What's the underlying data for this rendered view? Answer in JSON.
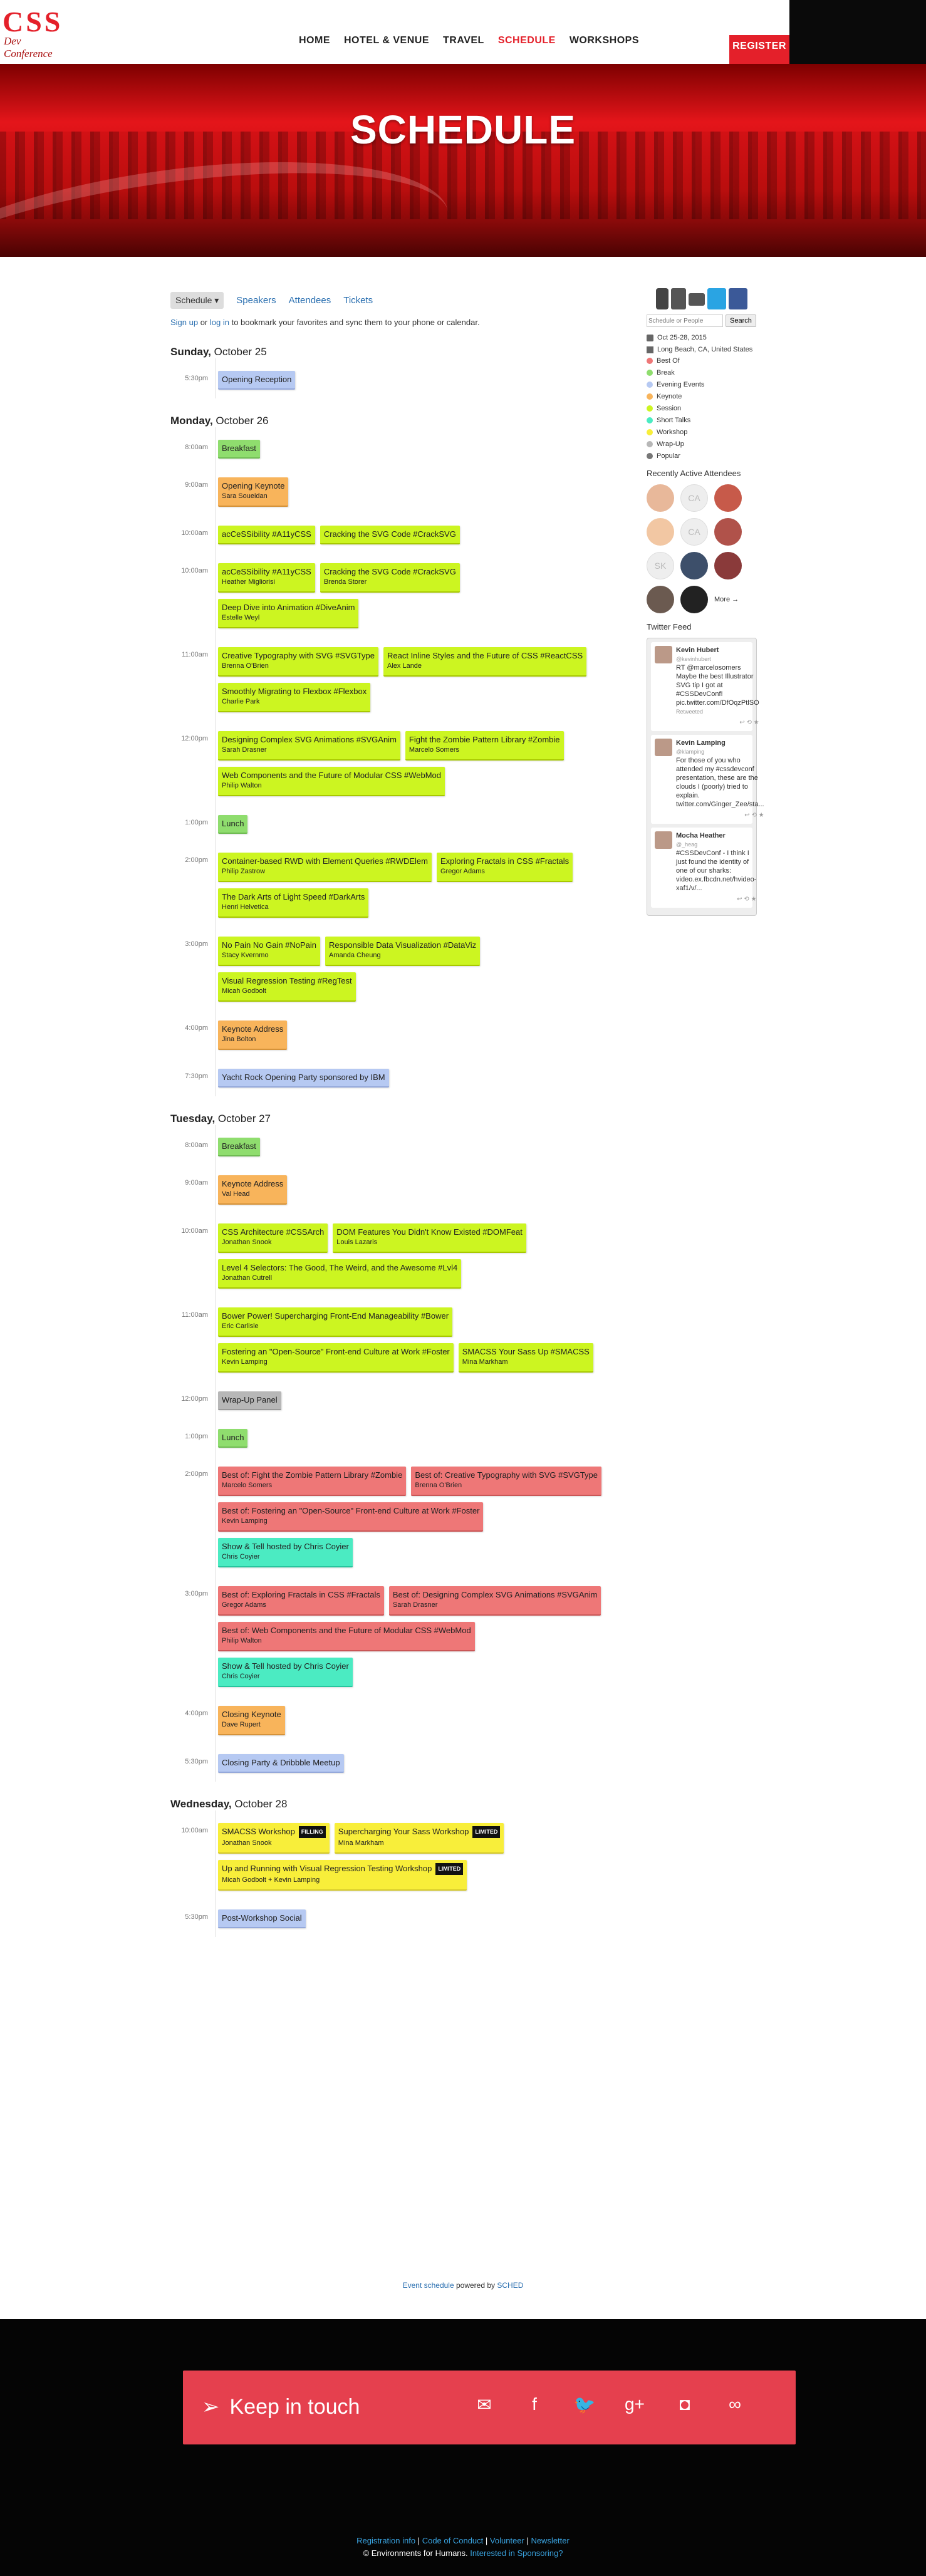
{
  "brand": {
    "logo_main": "CSS",
    "logo_sub": "Dev Conference"
  },
  "nav": [
    "HOME",
    "HOTEL & VENUE",
    "TRAVEL",
    "SCHEDULE",
    "WORKSHOPS"
  ],
  "register": "REGISTER",
  "hero_title": "SCHEDULE",
  "subnav": {
    "schedule": "Schedule ▾",
    "speakers": "Speakers",
    "attendees": "Attendees",
    "tickets": "Tickets"
  },
  "sync": {
    "signup": "Sign up",
    "or": " or ",
    "login": "log in",
    "rest": " to bookmark your favorites and sync them to your phone or calendar."
  },
  "days": [
    {
      "weekday": "Sunday,",
      "date": " October 25",
      "slots": [
        {
          "time": "5:30pm",
          "events": [
            {
              "title": "Opening Reception",
              "speaker": "",
              "color": "eb"
            }
          ]
        }
      ]
    },
    {
      "weekday": "Monday,",
      "date": " October 26",
      "slots": [
        {
          "time": "8:00am",
          "events": [
            {
              "title": "Breakfast",
              "speaker": "",
              "color": "eg"
            }
          ]
        },
        {
          "time": "9:00am",
          "events": [
            {
              "title": "Opening Keynote",
              "speaker": "Sara Soueidan",
              "color": "eo"
            }
          ]
        },
        {
          "time": "10:00am",
          "events": [
            {
              "title": "acCeSSibility #A11yCSS",
              "speaker": "",
              "color": "ey"
            },
            {
              "title": "Cracking the SVG Code #CrackSVG",
              "speaker": "",
              "color": "ey"
            }
          ]
        },
        {
          "time": "10:00am",
          "events": [
            {
              "title": "acCeSSibility #A11yCSS",
              "speaker": "Heather Migliorisi",
              "color": "ey"
            },
            {
              "title": "Cracking the SVG Code #CrackSVG",
              "speaker": "Brenda Storer",
              "color": "ey"
            },
            {
              "title": "Deep Dive into Animation #DiveAnim",
              "speaker": "Estelle Weyl",
              "color": "ey"
            }
          ]
        },
        {
          "time": "11:00am",
          "events": [
            {
              "title": "Creative Typography with SVG #SVGType",
              "speaker": "Brenna O'Brien",
              "color": "ey"
            },
            {
              "title": "React Inline Styles and the Future of CSS #ReactCSS",
              "speaker": "Alex Lande",
              "color": "ey"
            },
            {
              "title": "Smoothly Migrating to Flexbox #Flexbox",
              "speaker": "Charlie Park",
              "color": "ey"
            }
          ]
        },
        {
          "time": "12:00pm",
          "events": [
            {
              "title": "Designing Complex SVG Animations #SVGAnim",
              "speaker": "Sarah Drasner",
              "color": "ey"
            },
            {
              "title": "Fight the Zombie Pattern Library #Zombie",
              "speaker": "Marcelo Somers",
              "color": "ey"
            },
            {
              "title": "Web Components and the Future of Modular CSS #WebMod",
              "speaker": "Philip Walton",
              "color": "ey"
            }
          ]
        },
        {
          "time": "1:00pm",
          "events": [
            {
              "title": "Lunch",
              "speaker": "",
              "color": "eg"
            }
          ]
        },
        {
          "time": "2:00pm",
          "events": [
            {
              "title": "Container-based RWD with Element Queries #RWDElem",
              "speaker": "Philip Zastrow",
              "color": "ey"
            },
            {
              "title": "Exploring Fractals in CSS #Fractals",
              "speaker": "Gregor Adams",
              "color": "ey"
            },
            {
              "title": "The Dark Arts of Light Speed #DarkArts",
              "speaker": "Henri Helvetica",
              "color": "ey"
            }
          ]
        },
        {
          "time": "3:00pm",
          "events": [
            {
              "title": "No Pain No Gain #NoPain",
              "speaker": "Stacy Kvernmo",
              "color": "ey"
            },
            {
              "title": "Responsible Data Visualization #DataViz",
              "speaker": "Amanda Cheung",
              "color": "ey"
            },
            {
              "title": "Visual Regression Testing #RegTest",
              "speaker": "Micah Godbolt",
              "color": "ey"
            }
          ]
        },
        {
          "time": "4:00pm",
          "events": [
            {
              "title": "Keynote Address",
              "speaker": "Jina Bolton",
              "color": "eo"
            }
          ]
        },
        {
          "time": "7:30pm",
          "events": [
            {
              "title": "Yacht Rock Opening Party sponsored by IBM",
              "speaker": "",
              "color": "eb"
            }
          ]
        }
      ]
    },
    {
      "weekday": "Tuesday,",
      "date": " October 27",
      "slots": [
        {
          "time": "8:00am",
          "events": [
            {
              "title": "Breakfast",
              "speaker": "",
              "color": "eg"
            }
          ]
        },
        {
          "time": "9:00am",
          "events": [
            {
              "title": "Keynote Address",
              "speaker": "Val Head",
              "color": "eo"
            }
          ]
        },
        {
          "time": "10:00am",
          "events": [
            {
              "title": "CSS Architecture #CSSArch",
              "speaker": "Jonathan Snook",
              "color": "ey"
            },
            {
              "title": "DOM Features You Didn't Know Existed #DOMFeat",
              "speaker": "Louis Lazaris",
              "color": "ey"
            },
            {
              "title": "Level 4 Selectors: The Good, The Weird, and the Awesome #Lvl4",
              "speaker": "Jonathan Cutrell",
              "color": "ey"
            }
          ]
        },
        {
          "time": "11:00am",
          "events": [
            {
              "title": "Bower Power! Supercharging Front-End Manageability #Bower",
              "speaker": "Eric Carlisle",
              "color": "ey"
            },
            {
              "title": "Fostering an \"Open-Source\" Front-end Culture at Work #Foster",
              "speaker": "Kevin Lamping",
              "color": "ey"
            },
            {
              "title": "SMACSS Your Sass Up #SMACSS",
              "speaker": "Mina Markham",
              "color": "ey"
            }
          ]
        },
        {
          "time": "12:00pm",
          "events": [
            {
              "title": "Wrap-Up Panel",
              "speaker": "",
              "color": "egr"
            }
          ]
        },
        {
          "time": "1:00pm",
          "events": [
            {
              "title": "Lunch",
              "speaker": "",
              "color": "eg"
            }
          ]
        },
        {
          "time": "2:00pm",
          "events": [
            {
              "title": "Best of: Fight the Zombie Pattern Library #Zombie",
              "speaker": "Marcelo Somers",
              "color": "er"
            },
            {
              "title": "Best of: Creative Typography with SVG #SVGType",
              "speaker": "Brenna O'Brien",
              "color": "er"
            },
            {
              "title": "Best of: Fostering an \"Open-Source\" Front-end Culture at Work #Foster",
              "speaker": "Kevin Lamping",
              "color": "er"
            },
            {
              "title": "Show & Tell hosted by Chris Coyier",
              "speaker": "Chris Coyier",
              "color": "et"
            }
          ]
        },
        {
          "time": "3:00pm",
          "events": [
            {
              "title": "Best of: Exploring Fractals in CSS #Fractals",
              "speaker": "Gregor Adams",
              "color": "er"
            },
            {
              "title": "Best of: Designing Complex SVG Animations #SVGAnim",
              "speaker": "Sarah Drasner",
              "color": "er"
            },
            {
              "title": "Best of: Web Components and the Future of Modular CSS #WebMod",
              "speaker": "Philip Walton",
              "color": "er"
            },
            {
              "title": "Show & Tell hosted by Chris Coyier",
              "speaker": "Chris Coyier",
              "color": "et"
            }
          ]
        },
        {
          "time": "4:00pm",
          "events": [
            {
              "title": "Closing Keynote",
              "speaker": "Dave Rupert",
              "color": "eo"
            }
          ]
        },
        {
          "time": "5:30pm",
          "events": [
            {
              "title": "Closing Party & Dribbble Meetup",
              "speaker": "",
              "color": "eb"
            }
          ]
        }
      ]
    },
    {
      "weekday": "Wednesday,",
      "date": " October 28",
      "slots": [
        {
          "time": "10:00am",
          "events": [
            {
              "title": "SMACSS Workshop",
              "tag": "FILLING",
              "speaker": "Jonathan Snook",
              "color": "ew"
            },
            {
              "title": "Supercharging Your Sass Workshop",
              "tag": "LIMITED",
              "speaker": "Mina Markham",
              "color": "ew"
            },
            {
              "title": "Up and Running with Visual Regression Testing Workshop",
              "tag": "LIMITED",
              "speaker": "Micah Godbolt + Kevin Lamping",
              "color": "ew"
            }
          ]
        },
        {
          "time": "5:30pm",
          "events": [
            {
              "title": "Post-Workshop Social",
              "speaker": "",
              "color": "eb"
            }
          ]
        }
      ]
    }
  ],
  "sidebar": {
    "search_placeholder": "Schedule or People",
    "search_button": "Search",
    "dates": "Oct 25-28, 2015",
    "location": "Long Beach, CA, United States",
    "legend": [
      {
        "label": "Best Of",
        "color": "#ee7777"
      },
      {
        "label": "Break",
        "color": "#8fdd6e"
      },
      {
        "label": "Evening Events",
        "color": "#b6c9f2"
      },
      {
        "label": "Keynote",
        "color": "#f8b45b"
      },
      {
        "label": "Session",
        "color": "#ccf521"
      },
      {
        "label": "Short Talks",
        "color": "#4bebc2"
      },
      {
        "label": "Workshop",
        "color": "#f8ee3a"
      },
      {
        "label": "Wrap-Up",
        "color": "#b7b7b7"
      },
      {
        "label": "Popular",
        "color": "#777777"
      }
    ],
    "attendees_heading": "Recently Active Attendees",
    "avatars": [
      "",
      "CA",
      "",
      "",
      "CA",
      "",
      "SK",
      "",
      "",
      "",
      "",
      "More →"
    ],
    "twitter_heading": "Twitter Feed",
    "tweets": [
      {
        "name": "Kevin Hubert",
        "handle": "@kevinhubert",
        "text": "RT @marcelosomers Maybe the best Illustrator SVG tip I got at #CSSDevConf! pic.twitter.com/DfOqzPtlSO",
        "meta": "Retweeted"
      },
      {
        "name": "Kevin Lamping",
        "handle": "@klamping",
        "text": "For those of you who attended my #cssdevconf presentation, these are the clouds I (poorly) tried to explain. twitter.com/Ginger_Zee/sta..."
      },
      {
        "name": "Mocha Heather",
        "handle": "@_heag",
        "text": "#CSSDevConf - I think I just found the identity of one of our sharks: video.ex.fbcdn.net/hvideo-xaf1/v/..."
      }
    ]
  },
  "footer": {
    "event_schedule": "Event schedule",
    "powered": " powered by ",
    "sched": "SCHED",
    "keep": "Keep in touch",
    "links": [
      "Registration info",
      "Code of Conduct",
      "Volunteer",
      "Newsletter"
    ],
    "copy": "© Environments for Humans.",
    "sponsor": "Interested in Sponsoring?"
  }
}
